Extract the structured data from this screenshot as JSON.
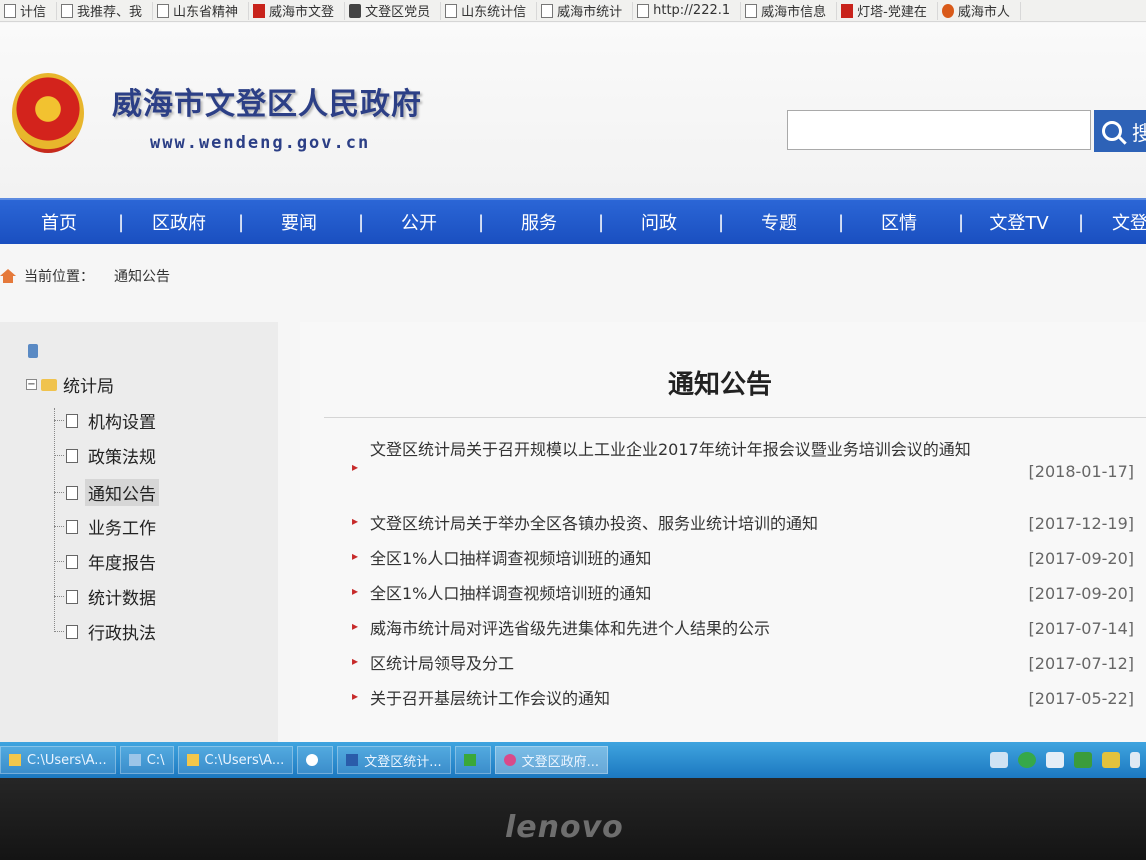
{
  "bookmarks": [
    {
      "label": "计信",
      "icon": "page-icon"
    },
    {
      "label": "我推荐、我",
      "icon": "page-icon"
    },
    {
      "label": "山东省精神",
      "icon": "page-icon"
    },
    {
      "label": "威海市文登",
      "icon": "party-emblem-icon"
    },
    {
      "label": "文登区党员",
      "icon": "edit-icon"
    },
    {
      "label": "山东统计信",
      "icon": "page-icon"
    },
    {
      "label": "威海市统计",
      "icon": "page-icon"
    },
    {
      "label": "http://222.1",
      "icon": "page-icon"
    },
    {
      "label": "威海市信息",
      "icon": "page-icon"
    },
    {
      "label": "灯塔-党建在",
      "icon": "lighthouse-icon"
    },
    {
      "label": "威海市人",
      "icon": "emblem-icon"
    }
  ],
  "header": {
    "title": "威海市文登区人民政府",
    "url": "www.wendeng.gov.cn",
    "search_placeholder": "",
    "search_button_label": "搜"
  },
  "nav": [
    "首页",
    "区政府",
    "要闻",
    "公开",
    "服务",
    "问政",
    "专题",
    "区情",
    "文登TV",
    "文登大"
  ],
  "breadcrumb": {
    "label": "当前位置：",
    "current": "通知公告"
  },
  "sidebar": {
    "root": "统计局",
    "items": [
      "机构设置",
      "政策法规",
      "通知公告",
      "业务工作",
      "年度报告",
      "统计数据",
      "行政执法"
    ],
    "active_index": 2
  },
  "main": {
    "title": "通知公告",
    "notices": [
      {
        "text": "文登区统计局关于召开规模以上工业企业2017年统计年报会议暨业务培训会议的通知",
        "date": "[2018-01-17]"
      },
      {
        "text": "文登区统计局关于举办全区各镇办投资、服务业统计培训的通知",
        "date": "[2017-12-19]"
      },
      {
        "text": "全区1%人口抽样调查视频培训班的通知",
        "date": "[2017-09-20]"
      },
      {
        "text": "全区1%人口抽样调查视频培训班的通知",
        "date": "[2017-09-20]"
      },
      {
        "text": "威海市统计局对评选省级先进集体和先进个人结果的公示",
        "date": "[2017-07-14]"
      },
      {
        "text": "区统计局领导及分工",
        "date": "[2017-07-12]"
      },
      {
        "text": "关于召开基层统计工作会议的通知",
        "date": "[2017-05-22]"
      }
    ]
  },
  "taskbar": {
    "tasks": [
      "C:\\Users\\A...",
      "C:\\",
      "C:\\Users\\A...",
      "",
      "文登区统计...",
      "",
      "文登区政府..."
    ],
    "active_index": 6
  },
  "monitor": {
    "brand": "lenovo"
  },
  "colors": {
    "nav_blue": "#1f57c8",
    "title_blue": "#2c3f86",
    "bullet_red": "#c72a2a",
    "taskbar_blue": "#2a8fd2"
  }
}
